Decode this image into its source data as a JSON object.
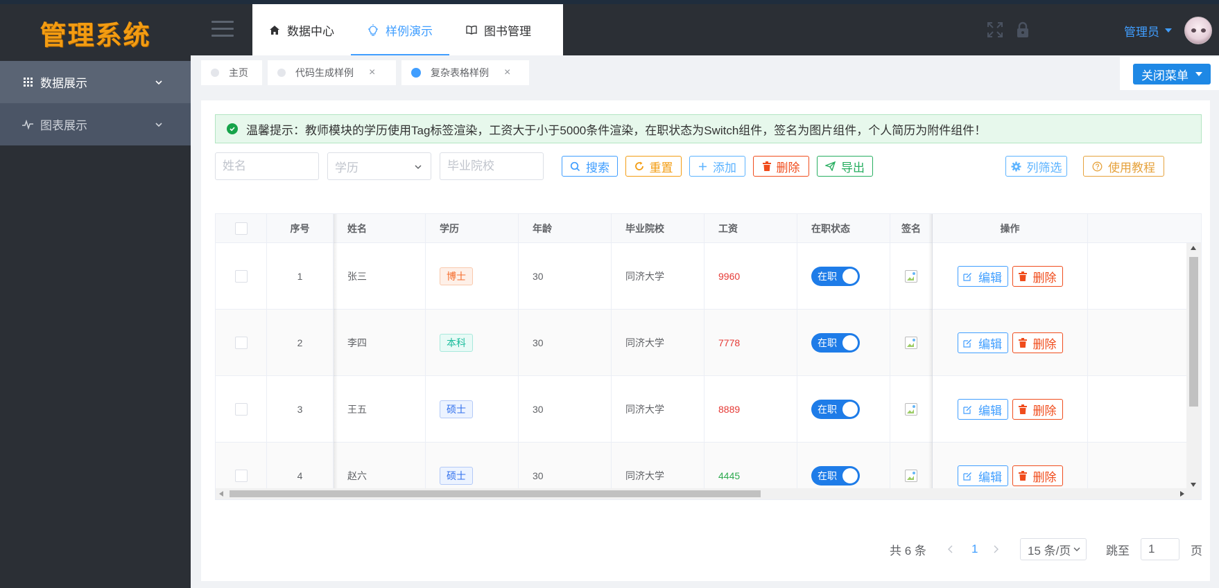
{
  "app": {
    "logo_text": "管理系统",
    "accent": "#409eff"
  },
  "sidebar": {
    "items": [
      {
        "label": "数据展示",
        "icon": "grid-icon",
        "active": true
      },
      {
        "label": "图表展示",
        "icon": "pulse-chart-icon",
        "active": false
      }
    ]
  },
  "topnav": {
    "items": [
      {
        "label": "数据中心",
        "icon": "home-icon",
        "active": false
      },
      {
        "label": "样例演示",
        "icon": "bulb-icon",
        "active": true
      },
      {
        "label": "图书管理",
        "icon": "book-icon",
        "active": false
      }
    ]
  },
  "header": {
    "user_name": "管理员",
    "icons": [
      "fullscreen-icon",
      "lock-icon"
    ]
  },
  "tags": {
    "items": [
      {
        "label": "主页",
        "closable": false,
        "active": false
      },
      {
        "label": "代码生成样例",
        "closable": true,
        "active": false
      },
      {
        "label": "复杂表格样例",
        "closable": true,
        "active": true
      }
    ],
    "close_icon_text": "×",
    "close_menu_label": "关闭菜单"
  },
  "alert": {
    "text": "温馨提示：教师模块的学历使用Tag标签渲染，工资大于小于5000条件渲染，在职状态为Switch组件，签名为图片组件，个人简历为附件组件！"
  },
  "filters": {
    "name_placeholder": "姓名",
    "education_placeholder": "学历",
    "school_placeholder": "毕业院校"
  },
  "toolbar": {
    "search": "搜索",
    "reset": "重置",
    "add": "添加",
    "delete": "删除",
    "export": "导出",
    "column_filter": "列筛选",
    "tutorial": "使用教程"
  },
  "table": {
    "headers": {
      "index": "序号",
      "name": "姓名",
      "education": "学历",
      "age": "年龄",
      "school": "毕业院校",
      "salary": "工资",
      "status": "在职状态",
      "signature": "签名",
      "actions": "操作"
    },
    "rows": [
      {
        "index": "1",
        "name": "张三",
        "education": "博士",
        "edu_type": "phd",
        "age": "30",
        "school": "同济大学",
        "salary": "9960",
        "salary_high": true,
        "status": "在职"
      },
      {
        "index": "2",
        "name": "李四",
        "education": "本科",
        "edu_type": "bach",
        "age": "30",
        "school": "同济大学",
        "salary": "7778",
        "salary_high": true,
        "status": "在职"
      },
      {
        "index": "3",
        "name": "王五",
        "education": "硕士",
        "edu_type": "mas",
        "age": "30",
        "school": "同济大学",
        "salary": "8889",
        "salary_high": true,
        "status": "在职"
      },
      {
        "index": "4",
        "name": "赵六",
        "education": "硕士",
        "edu_type": "mas",
        "age": "30",
        "school": "同济大学",
        "salary": "4445",
        "salary_high": false,
        "status": "在职"
      }
    ],
    "edit_label": "编辑",
    "delete_label": "删除"
  },
  "pagination": {
    "total": "共 6 条",
    "current_page": "1",
    "page_size": "15 条/页",
    "goto_label": "跳至",
    "goto_value": "1",
    "page_suffix": "页"
  }
}
